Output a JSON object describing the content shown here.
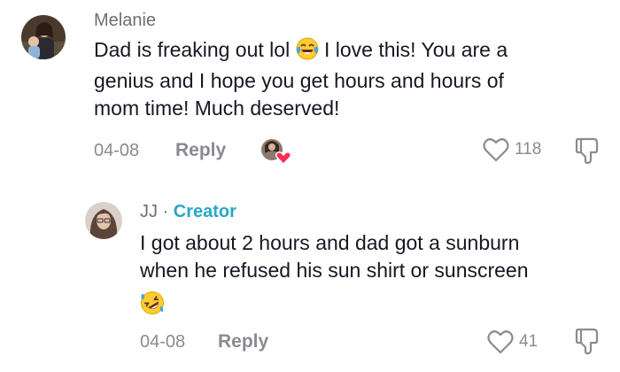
{
  "comment": {
    "username": "Melanie",
    "text_lines": [
      "Dad is freaking out lol",
      " I love this! You are a",
      "genius and I hope you get hours and hours of",
      "mom time! Much deserved!"
    ],
    "date": "04-08",
    "reply_label": "Reply",
    "like_count": "118"
  },
  "reply": {
    "username": "JJ",
    "separator": "·",
    "badge": "Creator",
    "text_lines": [
      "I got about 2 hours and dad got a sunburn",
      "when he refused his sun shirt or sunscreen"
    ],
    "date": "04-08",
    "reply_label": "Reply",
    "like_count": "41"
  },
  "colors": {
    "text": "#161823",
    "meta": "#8a8b91",
    "creator": "#2aa5c8",
    "heart_badge": "#fe2c55"
  },
  "icons": {
    "laughing_emoji": "face-with-tears-of-joy",
    "rofl_emoji": "rolling-on-the-floor-laughing",
    "like": "heart-outline",
    "dislike": "thumbs-down-outline",
    "creator_liked": "avatar-with-heart"
  }
}
